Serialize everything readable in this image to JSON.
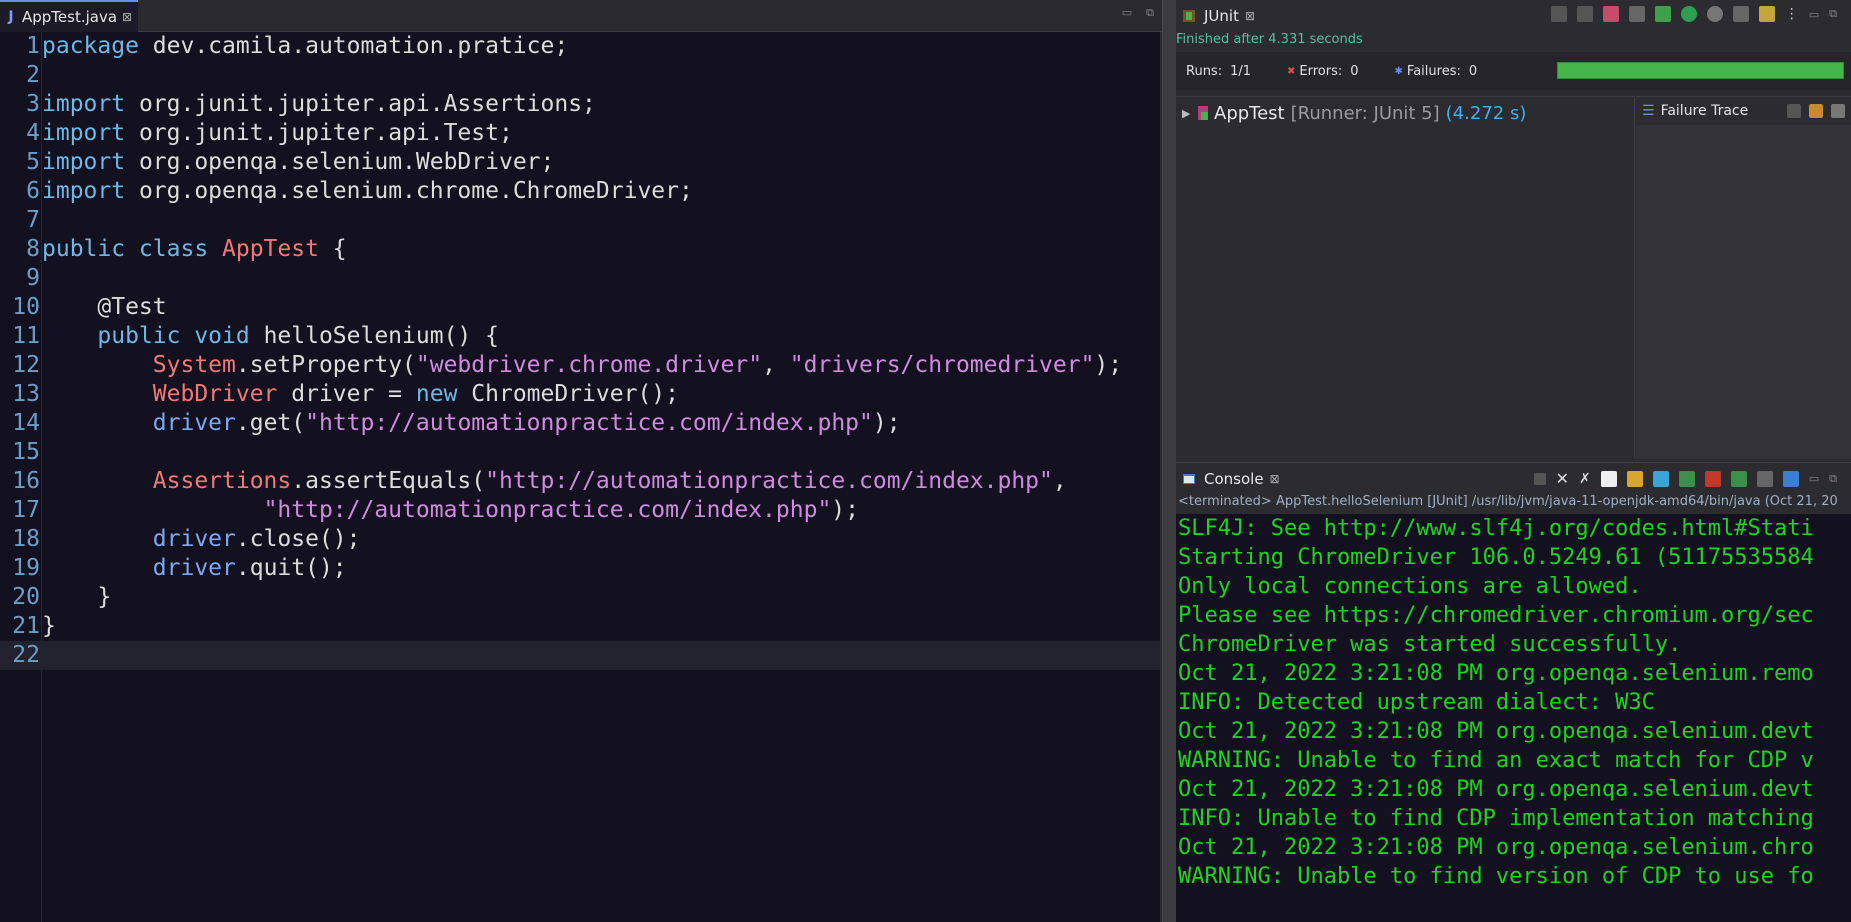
{
  "editor": {
    "tab_label": "AppTest.java",
    "tab_icon": "J",
    "lines": [
      {
        "n": "1",
        "segs": [
          [
            "kw",
            "package"
          ],
          [
            "pl",
            " dev.camila.automation.pratice;"
          ]
        ]
      },
      {
        "n": "2",
        "segs": []
      },
      {
        "n": "3",
        "segs": [
          [
            "kw",
            "import"
          ],
          [
            "pl",
            " org.junit.jupiter.api.Assertions;"
          ]
        ]
      },
      {
        "n": "4",
        "segs": [
          [
            "kw",
            "import"
          ],
          [
            "pl",
            " org.junit.jupiter.api.Test;"
          ]
        ]
      },
      {
        "n": "5",
        "segs": [
          [
            "kw",
            "import"
          ],
          [
            "pl",
            " org.openqa.selenium.WebDriver;"
          ]
        ]
      },
      {
        "n": "6",
        "segs": [
          [
            "kw",
            "import"
          ],
          [
            "pl",
            " org.openqa.selenium.chrome.ChromeDriver;"
          ]
        ]
      },
      {
        "n": "7",
        "segs": []
      },
      {
        "n": "8",
        "segs": [
          [
            "kw",
            "public class "
          ],
          [
            "cls",
            "AppTest"
          ],
          [
            "pl",
            " {"
          ]
        ]
      },
      {
        "n": "9",
        "segs": []
      },
      {
        "n": "10",
        "segs": [
          [
            "pl",
            "    @Test"
          ]
        ]
      },
      {
        "n": "11",
        "segs": [
          [
            "kw",
            "    public void "
          ],
          [
            "pl",
            "helloSelenium() {"
          ]
        ]
      },
      {
        "n": "12",
        "segs": [
          [
            "pl",
            "        "
          ],
          [
            "cls",
            "System"
          ],
          [
            "pl",
            ".setProperty("
          ],
          [
            "str",
            "\"webdriver.chrome.driver\""
          ],
          [
            "pl",
            ", "
          ],
          [
            "str",
            "\"drivers/chromedriver\""
          ],
          [
            "pl",
            ");"
          ]
        ]
      },
      {
        "n": "13",
        "segs": [
          [
            "pl",
            "        "
          ],
          [
            "cls",
            "WebDriver"
          ],
          [
            "pl",
            " driver = "
          ],
          [
            "kw",
            "new "
          ],
          [
            "pl",
            "ChromeDriver();"
          ]
        ]
      },
      {
        "n": "14",
        "segs": [
          [
            "pl",
            "        "
          ],
          [
            "mth",
            "driver"
          ],
          [
            "pl",
            ".get("
          ],
          [
            "str",
            "\"http://automationpractice.com/index.php\""
          ],
          [
            "pl",
            ");"
          ]
        ]
      },
      {
        "n": "15",
        "segs": []
      },
      {
        "n": "16",
        "segs": [
          [
            "pl",
            "        "
          ],
          [
            "cls",
            "Assertions"
          ],
          [
            "pl",
            ".assertEquals("
          ],
          [
            "str",
            "\"http://automationpractice.com/index.php\""
          ],
          [
            "pl",
            ","
          ]
        ]
      },
      {
        "n": "17",
        "segs": [
          [
            "pl",
            "                "
          ],
          [
            "str",
            "\"http://automationpractice.com/index.php\""
          ],
          [
            "pl",
            ");"
          ]
        ]
      },
      {
        "n": "18",
        "segs": [
          [
            "pl",
            "        "
          ],
          [
            "mth",
            "driver"
          ],
          [
            "pl",
            ".close();"
          ]
        ]
      },
      {
        "n": "19",
        "segs": [
          [
            "pl",
            "        "
          ],
          [
            "mth",
            "driver"
          ],
          [
            "pl",
            ".quit();"
          ]
        ]
      },
      {
        "n": "20",
        "segs": [
          [
            "pl",
            "    }"
          ]
        ]
      },
      {
        "n": "21",
        "segs": [
          [
            "pl",
            "}"
          ]
        ]
      },
      {
        "n": "22",
        "segs": [],
        "current": true
      }
    ]
  },
  "junit": {
    "tab_label": "JUnit",
    "status": "Finished after 4.331 seconds",
    "runs_label": "Runs:",
    "runs_value": "1/1",
    "errors_label": "Errors:",
    "errors_value": "0",
    "failures_label": "Failures:",
    "failures_value": "0",
    "progress": 1.0,
    "test_name": "AppTest",
    "runner": "[Runner: JUnit 5]",
    "time": "(4.272 s)",
    "failure_trace_label": "Failure Trace"
  },
  "console": {
    "tab_label": "Console",
    "terminated": "<terminated> AppTest.helloSelenium [JUnit] /usr/lib/jvm/java-11-openjdk-amd64/bin/java  (Oct 21, 20",
    "lines": [
      "SLF4J: See http://www.slf4j.org/codes.html#Stati",
      "Starting ChromeDriver 106.0.5249.61 (51175535584",
      "Only local connections are allowed.",
      "Please see https://chromedriver.chromium.org/sec",
      "ChromeDriver was started successfully.",
      "Oct 21, 2022 3:21:08 PM org.openqa.selenium.remo",
      "INFO: Detected upstream dialect: W3C",
      "Oct 21, 2022 3:21:08 PM org.openqa.selenium.devt",
      "WARNING: Unable to find an exact match for CDP v",
      "Oct 21, 2022 3:21:08 PM org.openqa.selenium.devt",
      "INFO: Unable to find CDP implementation matching",
      "Oct 21, 2022 3:21:08 PM org.openqa.selenium.chro",
      "WARNING: Unable to find version of CDP to use fo"
    ]
  },
  "colors": {
    "editor_bg": "#13111f",
    "keyword": "#6fb7e6",
    "class": "#ee7a78",
    "string": "#d08be0",
    "console_text": "#1ed41e",
    "progress": "#45b649"
  }
}
